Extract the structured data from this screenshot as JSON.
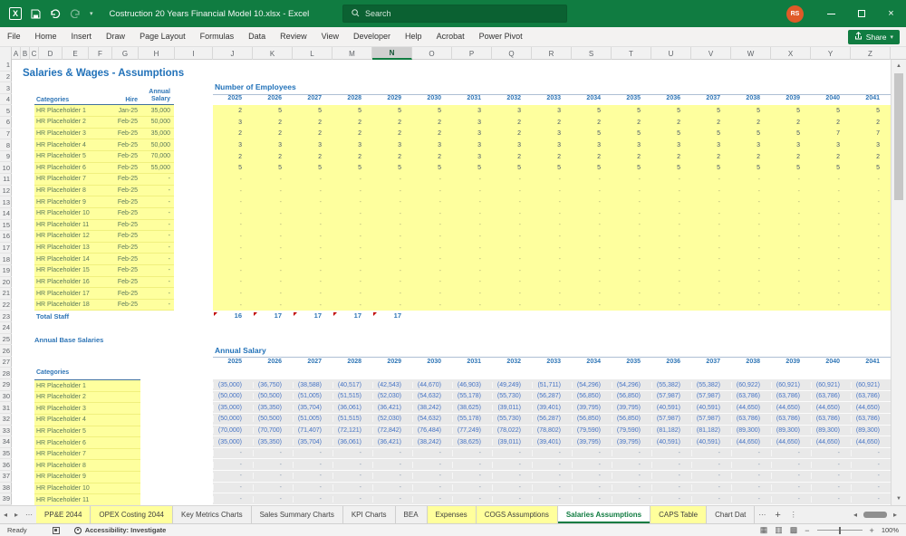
{
  "title_bar": {
    "title": "Costruction 20 Years Financial Model 10.xlsx  -  Excel",
    "search_placeholder": "Search",
    "avatar_initials": "RS"
  },
  "ribbon": {
    "tabs": [
      "File",
      "Home",
      "Insert",
      "Draw",
      "Page Layout",
      "Formulas",
      "Data",
      "Review",
      "View",
      "Developer",
      "Help",
      "Acrobat",
      "Power Pivot"
    ],
    "share_label": "Share"
  },
  "grid": {
    "column_letters": [
      "A",
      "B",
      "C",
      "D",
      "E",
      "F",
      "G",
      "H",
      "I",
      "J",
      "K",
      "L",
      "M",
      "N",
      "O",
      "P",
      "Q",
      "R",
      "S",
      "T",
      "U",
      "V",
      "W",
      "X",
      "Y",
      "Z"
    ],
    "selected_column": "N",
    "visible_rows": 39
  },
  "sheet": {
    "main_title": "Salaries & Wages - Assumptions",
    "staff_table": {
      "col_category": "Categories",
      "col_hire": "Hire",
      "col_salary": "Annual Salary",
      "rows": [
        {
          "category": "HR Placeholder 1",
          "hire": "Jan-25",
          "salary": "35,000"
        },
        {
          "category": "HR Placeholder 2",
          "hire": "Feb-25",
          "salary": "50,000"
        },
        {
          "category": "HR Placeholder 3",
          "hire": "Feb-25",
          "salary": "35,000"
        },
        {
          "category": "HR Placeholder 4",
          "hire": "Feb-25",
          "salary": "50,000"
        },
        {
          "category": "HR Placeholder 5",
          "hire": "Feb-25",
          "salary": "70,000"
        },
        {
          "category": "HR Placeholder 6",
          "hire": "Feb-25",
          "salary": "55,000"
        },
        {
          "category": "HR Placeholder 7",
          "hire": "Feb-25",
          "salary": "-"
        },
        {
          "category": "HR Placeholder 8",
          "hire": "Feb-25",
          "salary": "-"
        },
        {
          "category": "HR Placeholder 9",
          "hire": "Feb-25",
          "salary": "-"
        },
        {
          "category": "HR Placeholder 10",
          "hire": "Feb-25",
          "salary": "-"
        },
        {
          "category": "HR Placeholder 11",
          "hire": "Feb-25",
          "salary": "-"
        },
        {
          "category": "HR Placeholder 12",
          "hire": "Feb-25",
          "salary": "-"
        },
        {
          "category": "HR Placeholder 13",
          "hire": "Feb-25",
          "salary": "-"
        },
        {
          "category": "HR Placeholder 14",
          "hire": "Feb-25",
          "salary": "-"
        },
        {
          "category": "HR Placeholder 15",
          "hire": "Feb-25",
          "salary": "-"
        },
        {
          "category": "HR Placeholder 16",
          "hire": "Feb-25",
          "salary": "-"
        },
        {
          "category": "HR Placeholder 17",
          "hire": "Feb-25",
          "salary": "-"
        },
        {
          "category": "HR Placeholder 18",
          "hire": "Feb-25",
          "salary": "-"
        }
      ]
    },
    "total_staff_label": "Total Staff",
    "annual_base_label": "Annual Base Salaries",
    "categories_label": "Categories",
    "categories_list": [
      "HR Placeholder 1",
      "HR Placeholder 2",
      "HR Placeholder 3",
      "HR Placeholder 4",
      "HR Placeholder 5",
      "HR Placeholder 6",
      "HR Placeholder 7",
      "HR Placeholder 8",
      "HR Placeholder 9",
      "HR Placeholder 10",
      "HR Placeholder 11"
    ],
    "dash": "-",
    "employees": {
      "title": "Number of Employees",
      "years": [
        "2025",
        "2026",
        "2027",
        "2028",
        "2029",
        "2030",
        "2031",
        "2032",
        "2033",
        "2034",
        "2035",
        "2036",
        "2037",
        "2038",
        "2039",
        "2040",
        "2041"
      ],
      "rows": [
        [
          "2",
          "5",
          "5",
          "5",
          "5",
          "5",
          "3",
          "3",
          "3",
          "5",
          "5",
          "5",
          "5",
          "5",
          "5",
          "5",
          "5"
        ],
        [
          "3",
          "2",
          "2",
          "2",
          "2",
          "2",
          "3",
          "2",
          "2",
          "2",
          "2",
          "2",
          "2",
          "2",
          "2",
          "2",
          "2"
        ],
        [
          "2",
          "2",
          "2",
          "2",
          "2",
          "2",
          "3",
          "2",
          "3",
          "5",
          "5",
          "5",
          "5",
          "5",
          "5",
          "7",
          "7"
        ],
        [
          "3",
          "3",
          "3",
          "3",
          "3",
          "3",
          "3",
          "3",
          "3",
          "3",
          "3",
          "3",
          "3",
          "3",
          "3",
          "3",
          "3"
        ],
        [
          "2",
          "2",
          "2",
          "2",
          "2",
          "2",
          "3",
          "2",
          "2",
          "2",
          "2",
          "2",
          "2",
          "2",
          "2",
          "2",
          "2"
        ],
        [
          "5",
          "5",
          "5",
          "5",
          "5",
          "5",
          "5",
          "5",
          "5",
          "5",
          "5",
          "5",
          "5",
          "5",
          "5",
          "5",
          "5"
        ]
      ],
      "dash_row_count": 12,
      "totals": [
        "16",
        "17",
        "17",
        "17",
        "17"
      ]
    },
    "salaries": {
      "title": "Annual Salary",
      "years": [
        "2025",
        "2026",
        "2027",
        "2028",
        "2029",
        "2030",
        "2031",
        "2032",
        "2033",
        "2034",
        "2035",
        "2036",
        "2037",
        "2038",
        "2039",
        "2040",
        "2041"
      ],
      "rows": [
        [
          "(35,000)",
          "(36,750)",
          "(38,588)",
          "(40,517)",
          "(42,543)",
          "(44,670)",
          "(46,903)",
          "(49,249)",
          "(51,711)",
          "(54,296)",
          "(54,296)",
          "(55,382)",
          "(55,382)",
          "(60,922)",
          "(60,921)",
          "(60,921)",
          "(60,921)"
        ],
        [
          "(50,000)",
          "(50,500)",
          "(51,005)",
          "(51,515)",
          "(52,030)",
          "(54,632)",
          "(55,178)",
          "(55,730)",
          "(56,287)",
          "(56,850)",
          "(56,850)",
          "(57,987)",
          "(57,987)",
          "(63,786)",
          "(63,786)",
          "(63,786)",
          "(63,786)"
        ],
        [
          "(35,000)",
          "(35,350)",
          "(35,704)",
          "(36,061)",
          "(36,421)",
          "(38,242)",
          "(38,625)",
          "(39,011)",
          "(39,401)",
          "(39,795)",
          "(39,795)",
          "(40,591)",
          "(40,591)",
          "(44,650)",
          "(44,650)",
          "(44,650)",
          "(44,650)"
        ],
        [
          "(50,000)",
          "(50,500)",
          "(51,005)",
          "(51,515)",
          "(52,030)",
          "(54,632)",
          "(55,178)",
          "(55,730)",
          "(56,287)",
          "(56,850)",
          "(56,850)",
          "(57,987)",
          "(57,987)",
          "(63,786)",
          "(63,786)",
          "(63,786)",
          "(63,786)"
        ],
        [
          "(70,000)",
          "(70,700)",
          "(71,407)",
          "(72,121)",
          "(72,842)",
          "(76,484)",
          "(77,249)",
          "(78,022)",
          "(78,802)",
          "(79,590)",
          "(79,590)",
          "(81,182)",
          "(81,182)",
          "(89,300)",
          "(89,300)",
          "(89,300)",
          "(89,300)"
        ],
        [
          "(35,000)",
          "(35,350)",
          "(35,704)",
          "(36,061)",
          "(36,421)",
          "(38,242)",
          "(38,625)",
          "(39,011)",
          "(39,401)",
          "(39,795)",
          "(39,795)",
          "(40,591)",
          "(40,591)",
          "(44,650)",
          "(44,650)",
          "(44,650)",
          "(44,650)"
        ]
      ],
      "dash_row_count": 5
    }
  },
  "sheet_tabs": {
    "tabs": [
      {
        "label": "PP&E 2044",
        "style": "yellow"
      },
      {
        "label": "OPEX Costing 2044",
        "style": "yellow"
      },
      {
        "label": "Key Metrics Charts",
        "style": "plain"
      },
      {
        "label": "Sales Summary Charts",
        "style": "plain"
      },
      {
        "label": "KPI Charts",
        "style": "plain"
      },
      {
        "label": "BEA",
        "style": "plain"
      },
      {
        "label": "Expenses",
        "style": "yellow"
      },
      {
        "label": "COGS Assumptions",
        "style": "yellow"
      },
      {
        "label": "Salaries Assumptions",
        "style": "active"
      },
      {
        "label": "CAPS Table",
        "style": "yellow"
      },
      {
        "label": "Chart Dat",
        "style": "plain"
      }
    ]
  },
  "status_bar": {
    "ready": "Ready",
    "accessibility": "Accessibility: Investigate",
    "zoom": "100%"
  },
  "colors": {
    "titlebar_green": "#107c41",
    "heading_blue": "#2272b9",
    "yellow_fill": "#feff9e",
    "value_blue": "#4472c4"
  }
}
